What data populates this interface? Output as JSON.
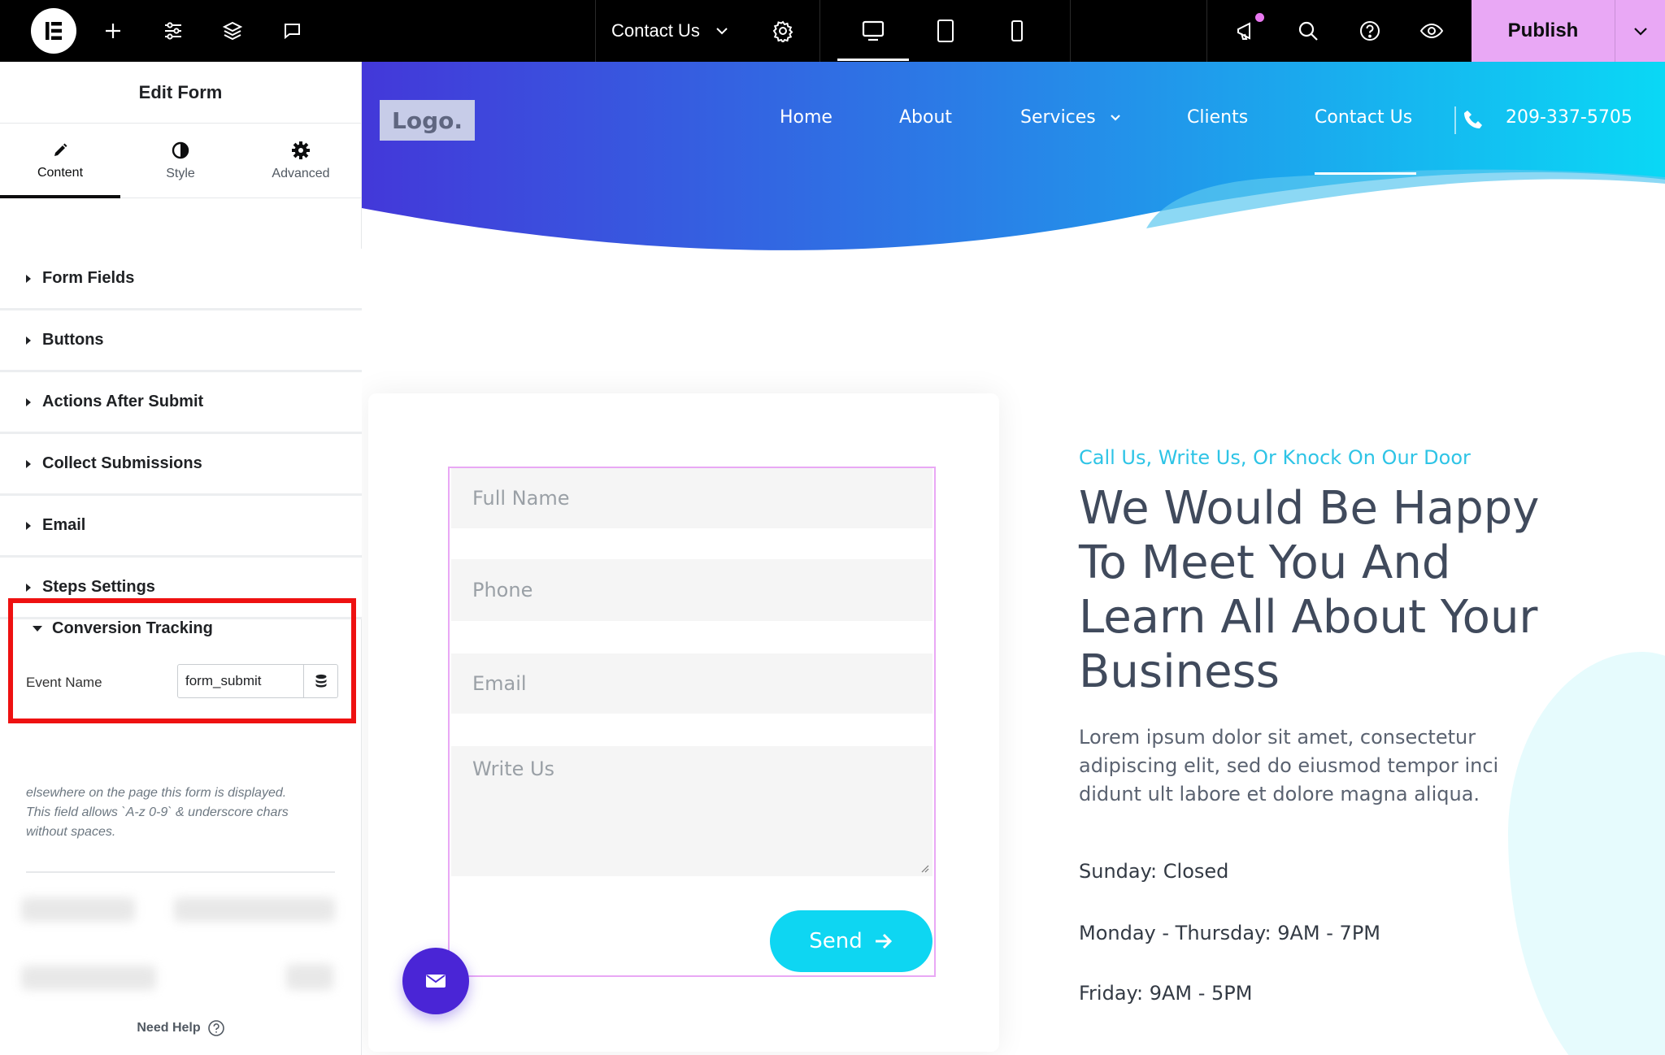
{
  "topbar": {
    "page_title": "Contact Us",
    "publish_label": "Publish",
    "icons": [
      "elementor-logo-icon",
      "add-icon",
      "settings-sliders-icon",
      "layers-icon",
      "comments-icon",
      "page-settings-gear-icon",
      "desktop-icon",
      "tablet-icon",
      "mobile-icon",
      "notifications-megaphone-icon",
      "search-icon",
      "help-icon",
      "preview-eye-icon",
      "chevron-down-icon"
    ]
  },
  "panel": {
    "title": "Edit Form",
    "tabs": [
      {
        "label": "Content",
        "icon": "pencil-icon",
        "active": true
      },
      {
        "label": "Style",
        "icon": "half-circle-icon",
        "active": false
      },
      {
        "label": "Advanced",
        "icon": "gear-icon",
        "active": false
      }
    ],
    "sections": [
      {
        "label": "Form Fields"
      },
      {
        "label": "Buttons"
      },
      {
        "label": "Actions After Submit"
      },
      {
        "label": "Collect Submissions"
      },
      {
        "label": "Email"
      },
      {
        "label": "Steps Settings"
      }
    ],
    "conversion": {
      "title": "Conversion Tracking",
      "event_label": "Event Name",
      "event_value": "form_submit",
      "help_line2": "elsewhere on the page this form is displayed.",
      "help_line3": "This field allows `A-z 0-9` & underscore chars",
      "help_line4": "without spaces."
    },
    "need_help": "Need Help"
  },
  "site": {
    "logo": "Logo.",
    "nav": [
      {
        "label": "Home"
      },
      {
        "label": "About"
      },
      {
        "label": "Services"
      },
      {
        "label": "Clients"
      },
      {
        "label": "Contact Us"
      }
    ],
    "phone": "209-337-5705",
    "colors": {
      "gradient_start": "#4338d9",
      "gradient_end": "#0ad8f5",
      "accent": "#0ed6f2",
      "form_outline": "#e9a8f5",
      "mail_button": "#4a25d6"
    }
  },
  "form": {
    "fields": [
      {
        "placeholder": "Full Name"
      },
      {
        "placeholder": "Phone"
      },
      {
        "placeholder": "Email"
      },
      {
        "placeholder": "Write Us"
      }
    ],
    "send_label": "Send"
  },
  "content": {
    "tagline": "Call Us, Write Us, Or Knock On Our Door",
    "heading": "We Would Be Happy To Meet You And Learn All About Your Business",
    "body": "Lorem ipsum dolor sit amet, consectetur adipiscing elit, sed do eiusmod tempor inci didunt ult labore et dolore magna aliqua.",
    "hours": [
      "Sunday: Closed",
      "Monday - Thursday: 9AM - 7PM",
      "Friday: 9AM - 5PM"
    ]
  }
}
